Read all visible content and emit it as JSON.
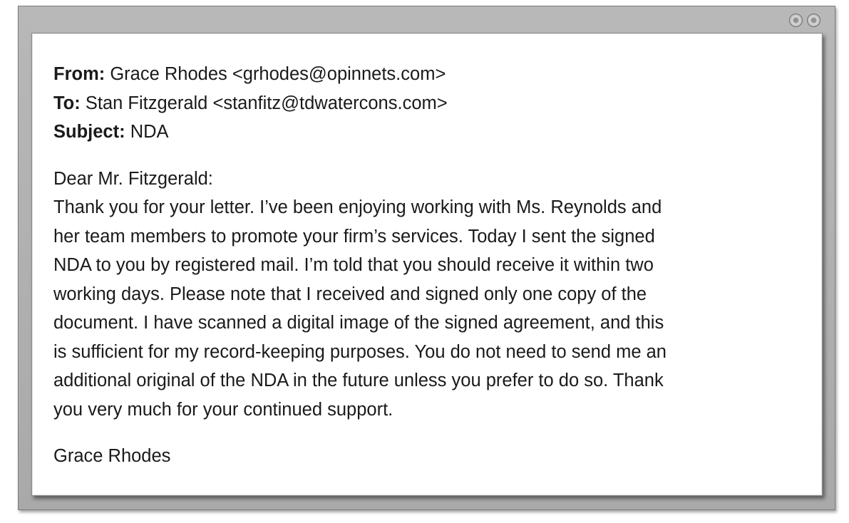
{
  "window": {
    "controls": [
      "minimize-icon",
      "maximize-icon"
    ]
  },
  "email": {
    "from_label": "From:",
    "from_value": "Grace Rhodes <grhodes@opinnets.com>",
    "to_label": "To:",
    "to_value": "Stan Fitzgerald <stanfitz@tdwatercons.com>",
    "subject_label": "Subject:",
    "subject_value": "NDA",
    "salutation": "Dear Mr. Fitzgerald:",
    "body_lines": [
      "Thank you for your letter. I’ve been enjoying working with Ms. Reynolds and",
      "her team members to promote your firm’s services. Today I sent the signed",
      "NDA to you by registered mail. I’m told that you should receive it within two",
      "working days. Please note that I received and signed only one copy of the",
      "document. I have scanned a digital image of the signed agreement, and this",
      "is sufficient for my record-keeping purposes. You do not need to send me an",
      "additional original of the NDA in the future unless you prefer to do so. Thank",
      "you very much for your continued support."
    ],
    "signature": "Grace Rhodes"
  }
}
